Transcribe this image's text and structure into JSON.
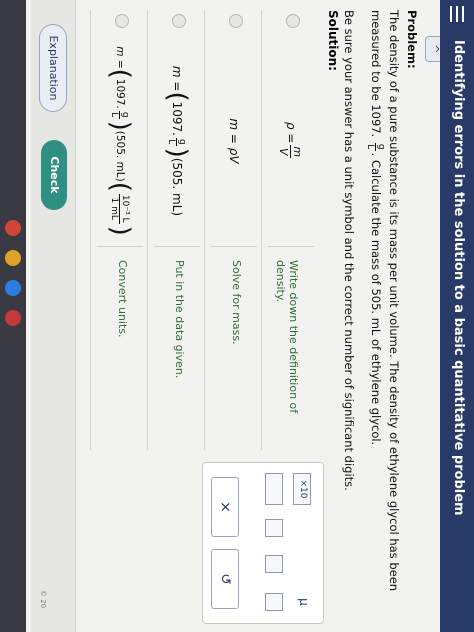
{
  "header": {
    "title": "Identifying errors in the solution to a basic quantitative problem",
    "collapse_glyph": "^"
  },
  "problem": {
    "heading": "Problem:",
    "text1": "The density of a pure substance is its mass per unit volume. The density of ethylene glycol has been measured to be 1097.",
    "unit_num": "g",
    "unit_den": "L",
    "text2": ". Calculate the mass of 505. mL of ethylene glycol.",
    "hint": "Be sure your answer has a unit symbol and the correct number of significant digits."
  },
  "solution": {
    "heading": "Solution:",
    "rows": [
      {
        "lhs": "ρ =",
        "num": "m",
        "den": "V",
        "description": "Write down the definition of density."
      },
      {
        "formula": "m = ρV",
        "description": "Solve for mass."
      },
      {
        "lhs": "m =",
        "value": "1097.",
        "num": "g",
        "den": "L",
        "rest": "(505. mL)",
        "description": "Put in the data given."
      },
      {
        "lhs": "m =",
        "value": "1097.",
        "num": "g",
        "den": "L",
        "rest": "(505. mL)",
        "conv_num": "10⁻³ L",
        "conv_den": "1 mL",
        "description": "Convert units."
      }
    ]
  },
  "toolbox": {
    "x10_label": "×10",
    "mu_label": "μ",
    "close_label": "×",
    "undo_label": "↺"
  },
  "footer": {
    "explanation_label": "Explanation",
    "check_label": "Check",
    "copyright": "© 20"
  }
}
